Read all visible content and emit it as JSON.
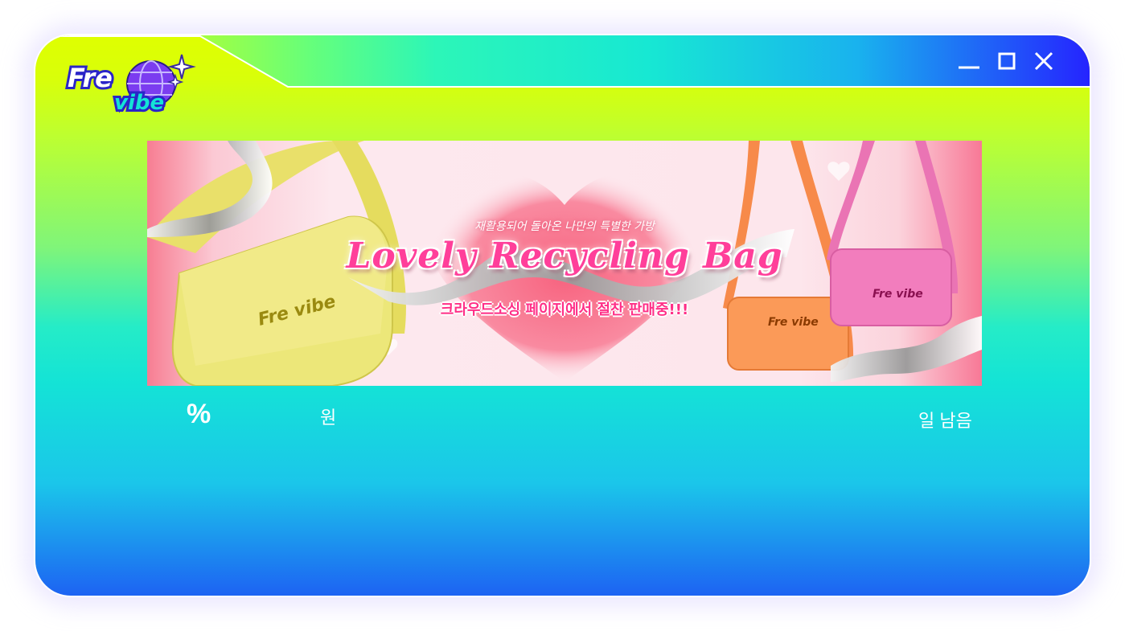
{
  "app": {
    "brand": "Frevibe"
  },
  "window_controls": {
    "minimize": "minimize",
    "maximize": "maximize",
    "close": "close"
  },
  "banner": {
    "subtitle": "재활용되어 돌아온 나만의 특별한 가방",
    "title": "Lovely Recycling Bag",
    "cta": "크라우드소싱 페이지에서 절찬 판매중!!!",
    "bag_logo_text": "Fre vibe"
  },
  "stats": {
    "percent_label": "%",
    "amount_unit": "원",
    "days_left": "일 남음"
  },
  "colors": {
    "accent_lime": "#dfff00",
    "accent_cyan": "#14e3d6",
    "accent_blue": "#2524ff",
    "title_pink": "#ff3f9a"
  }
}
